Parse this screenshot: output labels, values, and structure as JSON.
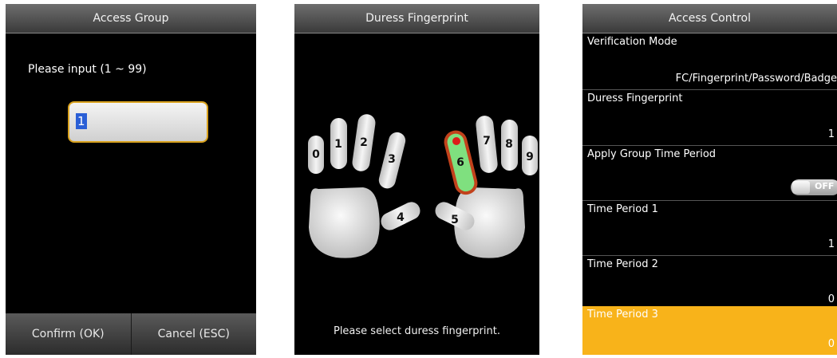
{
  "access_group": {
    "title": "Access Group",
    "prompt": "Please input (1 ~ 99)",
    "input_value": "1",
    "confirm_label": "Confirm (OK)",
    "cancel_label": "Cancel (ESC)"
  },
  "duress": {
    "title": "Duress Fingerprint",
    "fingers": [
      "0",
      "1",
      "2",
      "3",
      "4",
      "5",
      "6",
      "7",
      "8",
      "9"
    ],
    "selected_finger": "6",
    "hint": "Please select duress fingerprint."
  },
  "access_control": {
    "title": "Access Control",
    "rows": [
      {
        "label": "Verification Mode",
        "value": "FC/Fingerprint/Password/Badge"
      },
      {
        "label": "Duress Fingerprint",
        "value": "1"
      },
      {
        "label": "Apply Group Time Period",
        "value": "OFF"
      },
      {
        "label": "Time Period 1",
        "value": "1"
      },
      {
        "label": "Time Period 2",
        "value": "0"
      },
      {
        "label": "Time Period 3",
        "value": "0"
      }
    ],
    "selected_row": "Time Period 3"
  },
  "colors": {
    "accent": "#f8b31a",
    "selected_finger_fill": "#7fe07f",
    "selected_finger_border": "#c2421c",
    "input_border": "#d9a21e",
    "input_highlight": "#2a5fd6"
  }
}
